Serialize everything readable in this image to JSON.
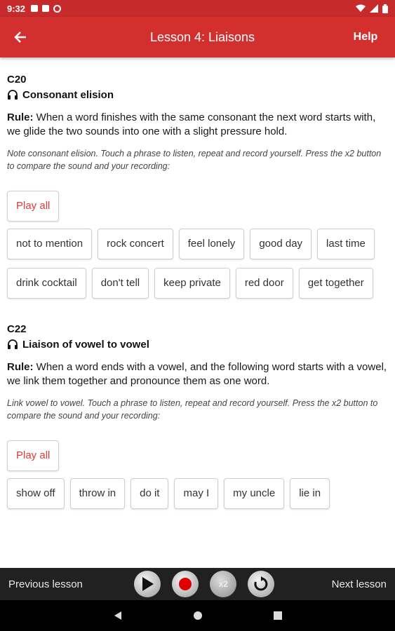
{
  "status": {
    "time": "9:32"
  },
  "appbar": {
    "title": "Lesson 4: Liaisons",
    "help": "Help"
  },
  "sections": [
    {
      "code": "C20",
      "subtitle": "Consonant elision",
      "rule_label": "Rule:",
      "rule_text": " When a word finishes with the same consonant the next word starts with, we glide the two sounds into one with a slight pressure hold.",
      "note": "Note consonant elision. Touch a phrase to listen, repeat and record yourself. Press the x2 button to compare the sound and your recording:",
      "play_all": "Play all",
      "phrases": [
        "not to mention",
        "rock concert",
        "feel lonely",
        "good day",
        "last time",
        "drink cocktail",
        "don't tell",
        "keep private",
        "red door",
        "get together"
      ]
    },
    {
      "code": "C22",
      "subtitle": "Liaison of vowel to vowel",
      "rule_label": "Rule:",
      "rule_text": " When a word ends with a vowel, and the following word starts with a vowel, we link them together and pronounce them as one word.",
      "note": "Link vowel to vowel. Touch a phrase to listen, repeat and record yourself. Press the x2 button to compare the sound and your recording:",
      "play_all": "Play all",
      "phrases": [
        "show off",
        "throw in",
        "do it",
        "may I",
        "my uncle",
        "lie in"
      ]
    }
  ],
  "controls": {
    "previous": "Previous lesson",
    "next": "Next lesson",
    "x2_label": "x2"
  },
  "colors": {
    "appbar": "#d32f2f",
    "accent_red": "#e53935",
    "controls_bg": "#212121"
  },
  "icons": {
    "back": "arrow-left-icon",
    "headphones": "headphones-icon",
    "play": "play-icon",
    "record": "record-icon",
    "compare": "x2-icon",
    "replay": "replay-icon"
  }
}
